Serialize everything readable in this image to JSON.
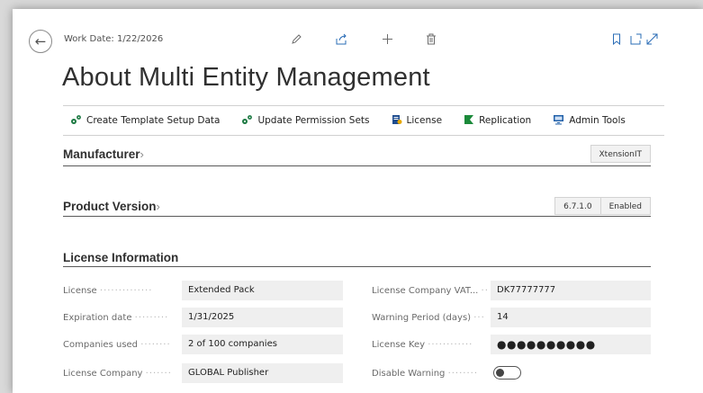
{
  "header": {
    "work_date": "Work Date: 1/22/2026",
    "title": "About Multi Entity Management",
    "toolbar_icons": [
      "pencil-icon",
      "share-icon",
      "plus-icon",
      "trash-icon",
      "bookmark-icon",
      "open-new-window-icon",
      "expand-icon"
    ]
  },
  "actions": [
    {
      "label": "Create Template Setup Data",
      "icon": "cogs-icon"
    },
    {
      "label": "Update Permission Sets",
      "icon": "cogs-icon"
    },
    {
      "label": "License",
      "icon": "license-icon"
    },
    {
      "label": "Replication",
      "icon": "replication-icon"
    },
    {
      "label": "Admin Tools",
      "icon": "admin-tools-icon"
    }
  ],
  "manufacturer": {
    "title": "Manufacturer",
    "chevron": "›",
    "value": "XtensionIT"
  },
  "product_version": {
    "title": "Product Version",
    "chevron": "›",
    "version": "6.7.1.0",
    "status": "Enabled"
  },
  "license_info": {
    "title": "License Information",
    "fields_left": [
      {
        "label": "License",
        "value": "Extended Pack"
      },
      {
        "label": "Expiration date",
        "value": "1/31/2025"
      },
      {
        "label": "Companies used",
        "value": "2 of 100 companies"
      },
      {
        "label": "License Company",
        "value": "GLOBAL Publisher"
      }
    ],
    "fields_right": [
      {
        "label": "License Company VAT...",
        "value": "DK77777777"
      },
      {
        "label": "Warning Period (days)",
        "value": "14"
      },
      {
        "label": "License Key",
        "value": "●●●●●●●●●●"
      },
      {
        "label": "Disable Warning",
        "value": false
      }
    ]
  },
  "colors": {
    "accent": "#2a6cb6",
    "field_bg": "#efefef"
  }
}
